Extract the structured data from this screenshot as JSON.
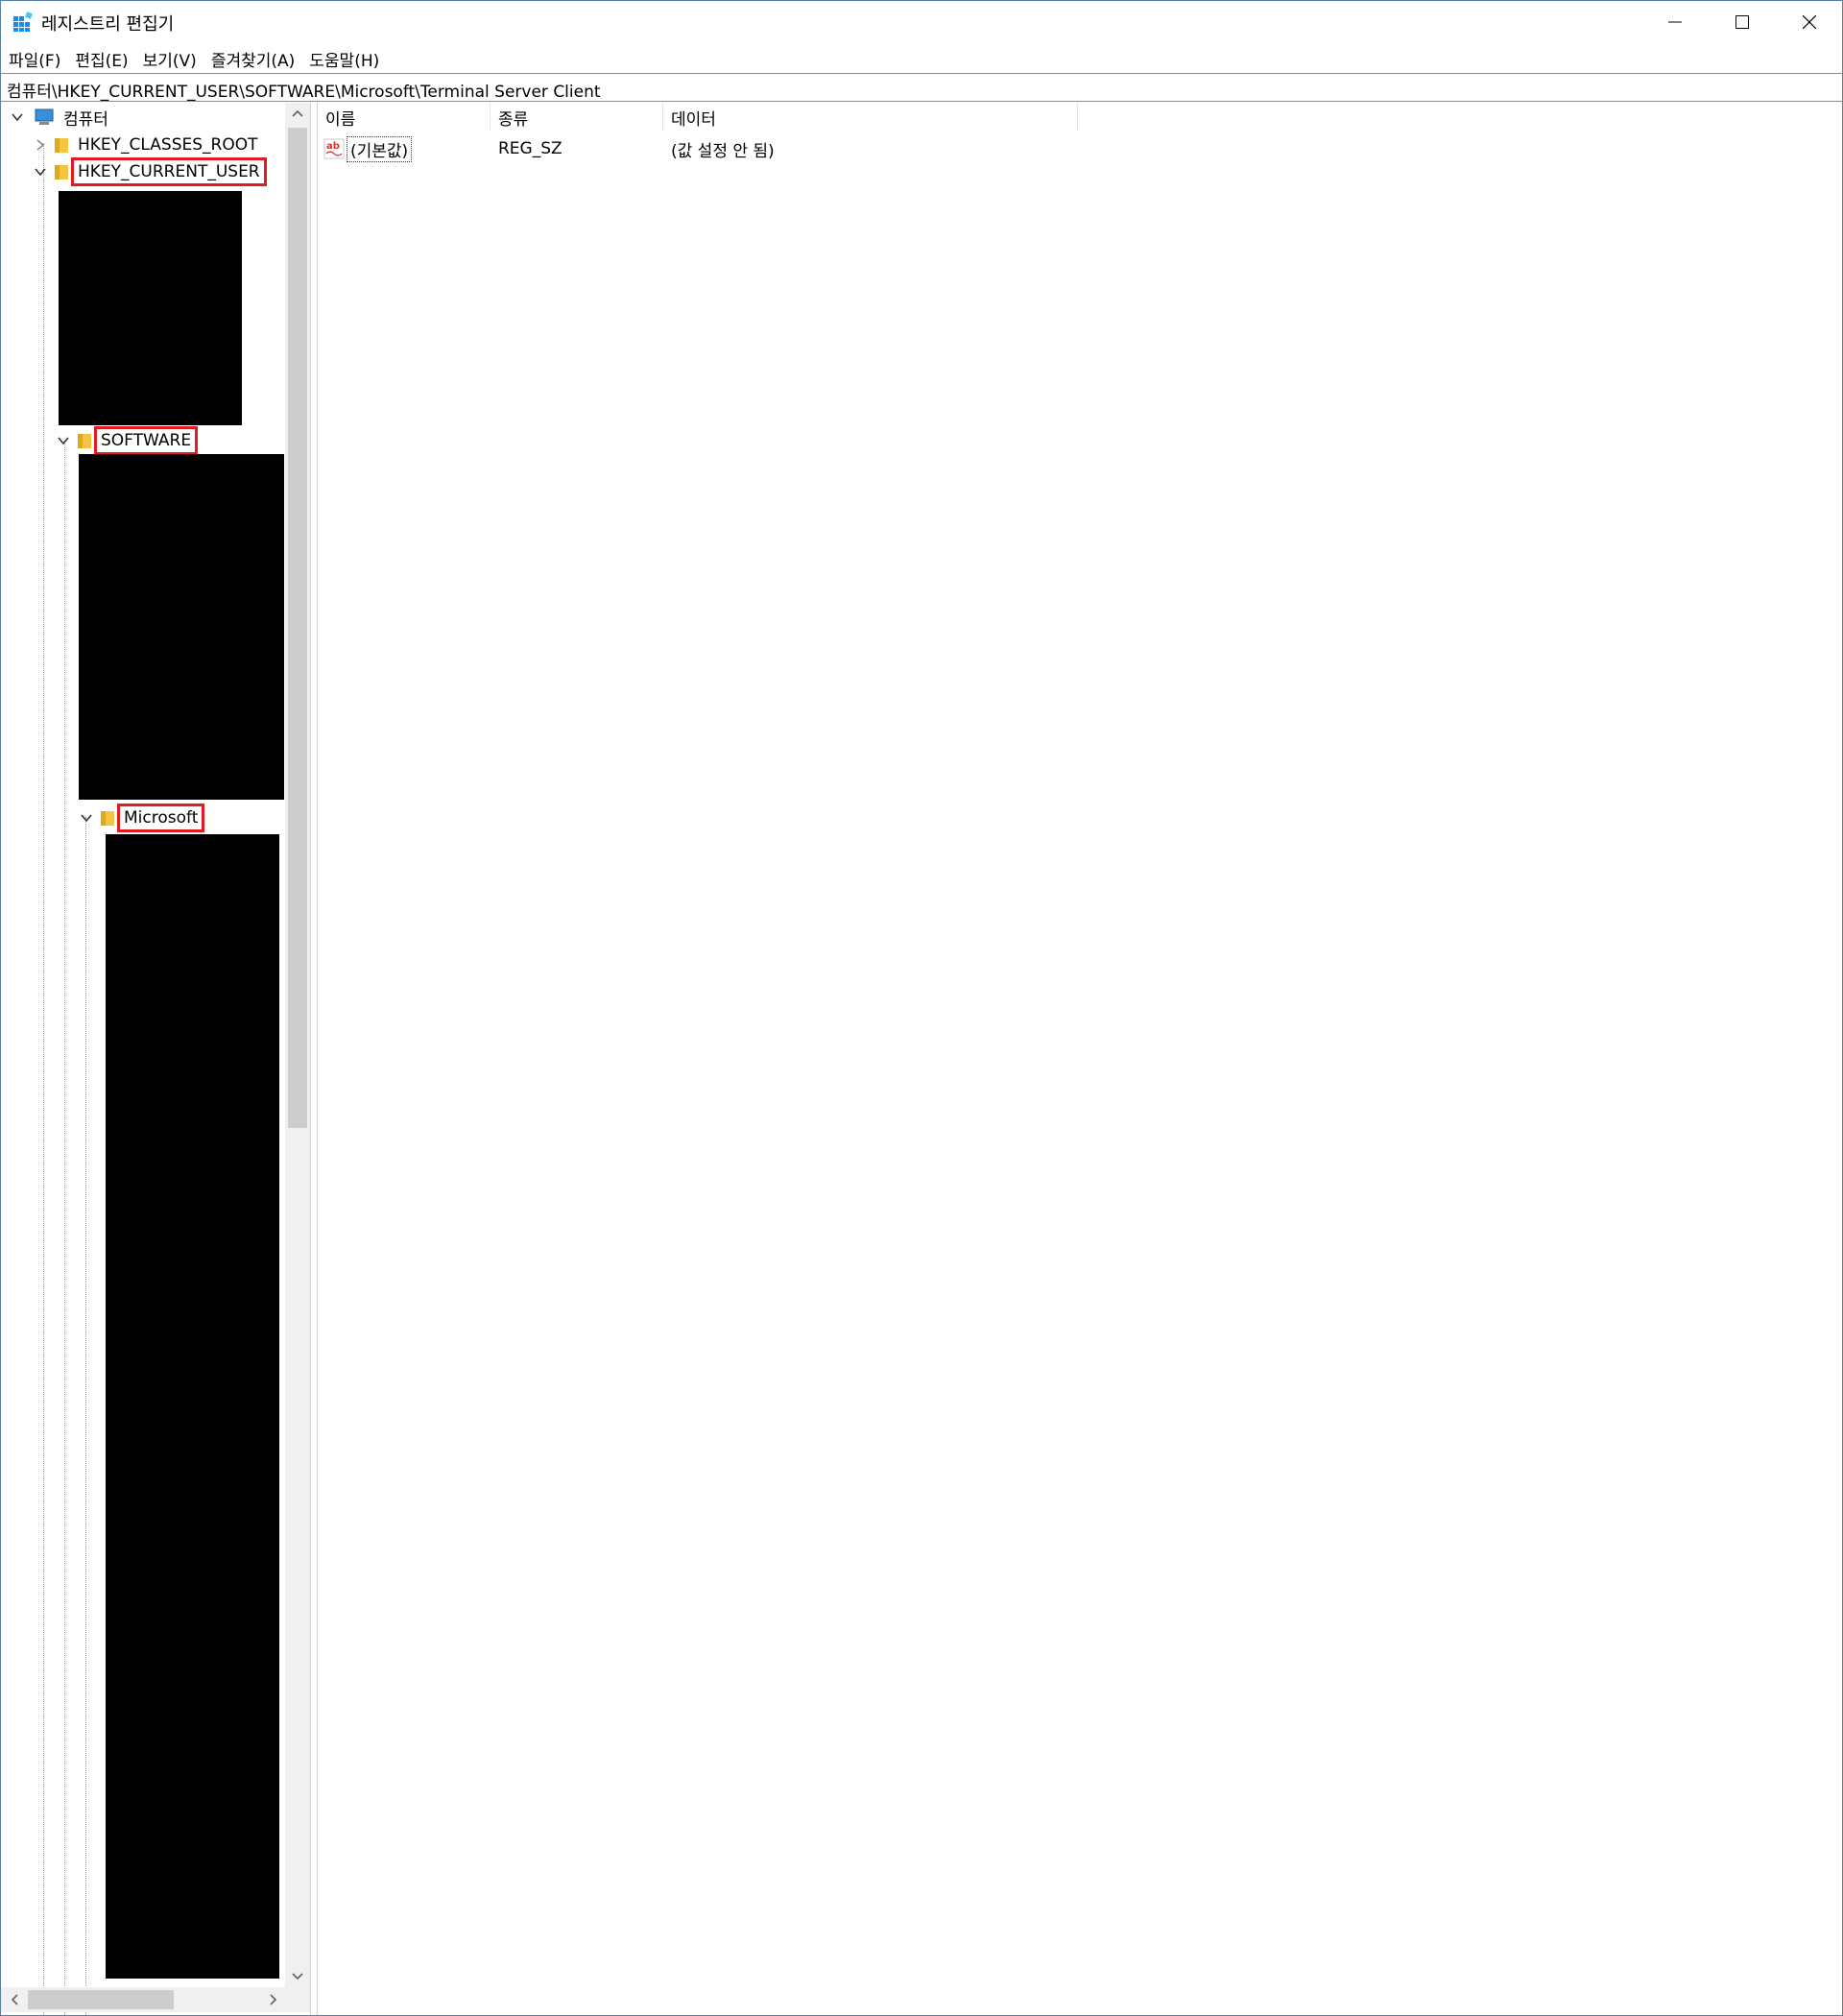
{
  "window": {
    "title": "레지스트리 편집기"
  },
  "menu": {
    "items": [
      "파일(F)",
      "편집(E)",
      "보기(V)",
      "즐겨찾기(A)",
      "도움말(H)"
    ]
  },
  "address": {
    "path": "컴퓨터\\HKEY_CURRENT_USER\\SOFTWARE\\Microsoft\\Terminal Server Client"
  },
  "tree": {
    "root": "컴퓨터",
    "hkcr": "HKEY_CLASSES_ROOT",
    "hkcu": "HKEY_CURRENT_USER",
    "software": "SOFTWARE",
    "microsoft": "Microsoft"
  },
  "list": {
    "columns": [
      "이름",
      "종류",
      "데이터"
    ],
    "rows": [
      {
        "name": "(기본값)",
        "type": "REG_SZ",
        "data": "(값 설정 안 됨)"
      }
    ]
  },
  "colors": {
    "highlight": "#e21b23",
    "folder": "#f5c542",
    "accent": "#0078d7"
  }
}
